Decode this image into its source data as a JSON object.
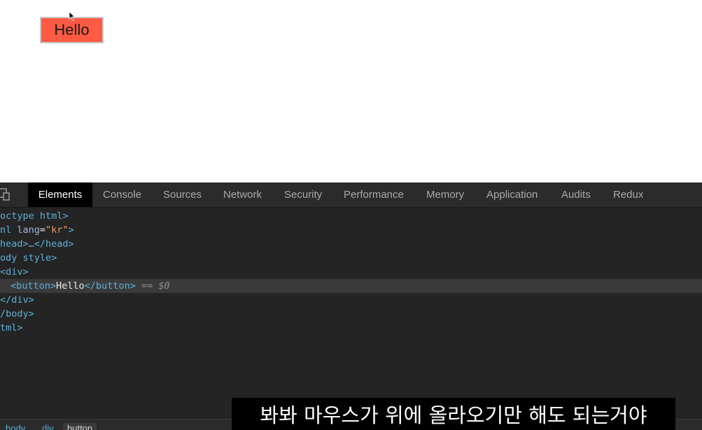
{
  "page": {
    "button_label": "Hello"
  },
  "devtools": {
    "tabs": [
      "Elements",
      "Console",
      "Sources",
      "Network",
      "Security",
      "Performance",
      "Memory",
      "Application",
      "Audits",
      "Redux"
    ],
    "active_tab": "Elements",
    "code_lines": {
      "l1": "octype html>",
      "l2_pre": "nl ",
      "l2_attr": "lang",
      "l2_eq": "=",
      "l2_val": "\"kr\"",
      "l2_post": ">",
      "l3": "head>…</head>",
      "l4": "ody style>",
      "l5": "<div>",
      "l6_open": "<button>",
      "l6_text": "Hello",
      "l6_close": "</button>",
      "l6_ref": " == $0",
      "l7": "</div>",
      "l8": "/body>",
      "l9": "tml>"
    },
    "breadcrumbs": [
      "body",
      "div",
      "button"
    ]
  },
  "subtitle": "봐봐 마우스가 위에 올라오기만 해도 되는거야",
  "colors": {
    "button_bg": "#ff5a43",
    "devtools_bg": "#242424",
    "tag": "#5db0d7",
    "attr_value": "#f29766"
  }
}
